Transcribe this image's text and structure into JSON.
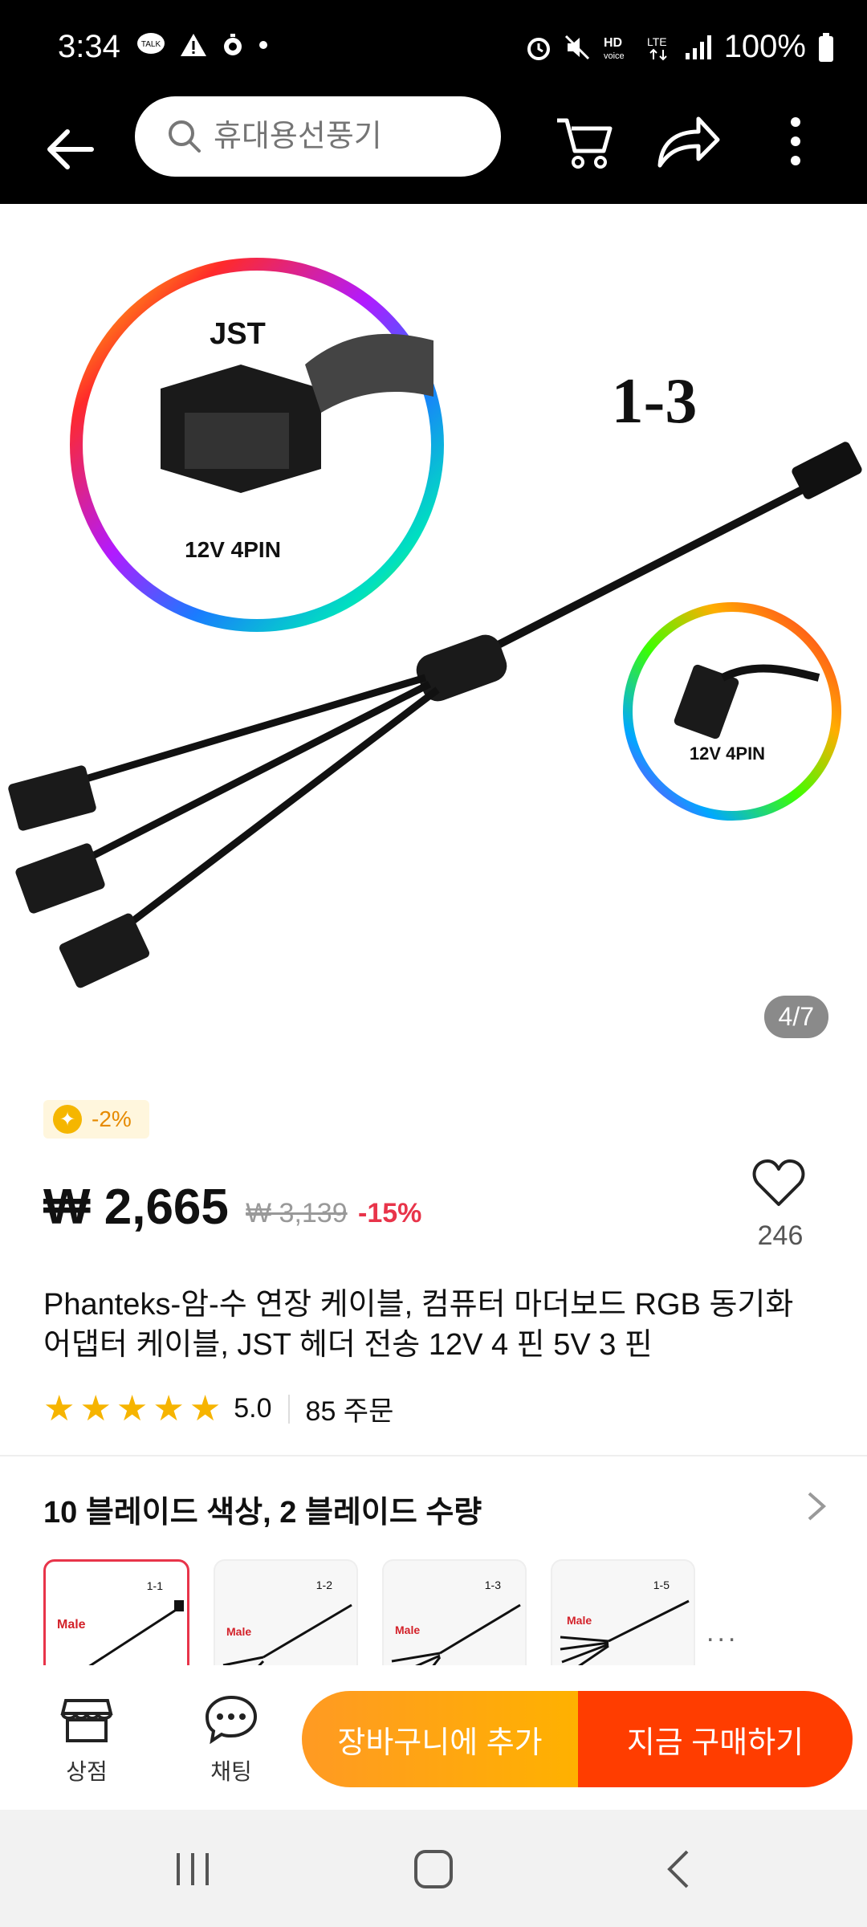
{
  "status_bar": {
    "time": "3:34",
    "battery": "100%"
  },
  "search": {
    "placeholder": "휴대용선풍기"
  },
  "gallery": {
    "counter": "4/7",
    "labels": {
      "jst": "JST",
      "pin_left": "12V 4PIN",
      "split": "1-3",
      "pin_right": "12V 4PIN"
    }
  },
  "promo": {
    "badge": "-2%"
  },
  "price": {
    "current": "₩ 2,665",
    "original": "₩ 3,139",
    "discount": "-15%"
  },
  "likes": {
    "count": "246"
  },
  "product": {
    "title": "Phanteks-암-수 연장 케이블, 컴퓨터 마더보드 RGB 동기화 어댑터 케이블, JST 헤더 전송 12V 4 핀 5V 3 핀"
  },
  "rating": {
    "score": "5.0",
    "orders": "85 주문",
    "stars": 5
  },
  "variants": {
    "title": "10 블레이드 색상, 2 블레이드 수량",
    "items": [
      {
        "label": "1-1",
        "tag": "Male"
      },
      {
        "label": "1-2",
        "tag": "Male"
      },
      {
        "label": "1-3",
        "tag": "Male"
      },
      {
        "label": "1-5",
        "tag": "Male"
      }
    ],
    "more": "..."
  },
  "bottom_bar": {
    "store_label": "상점",
    "chat_label": "채팅",
    "cart_label": "장바구니에 추가",
    "buy_label": "지금 구매하기"
  },
  "colors": {
    "accent_orange": "#ff9a23",
    "accent_red": "#ff3d00",
    "price_red": "#e8344a",
    "star": "#f6b400"
  }
}
